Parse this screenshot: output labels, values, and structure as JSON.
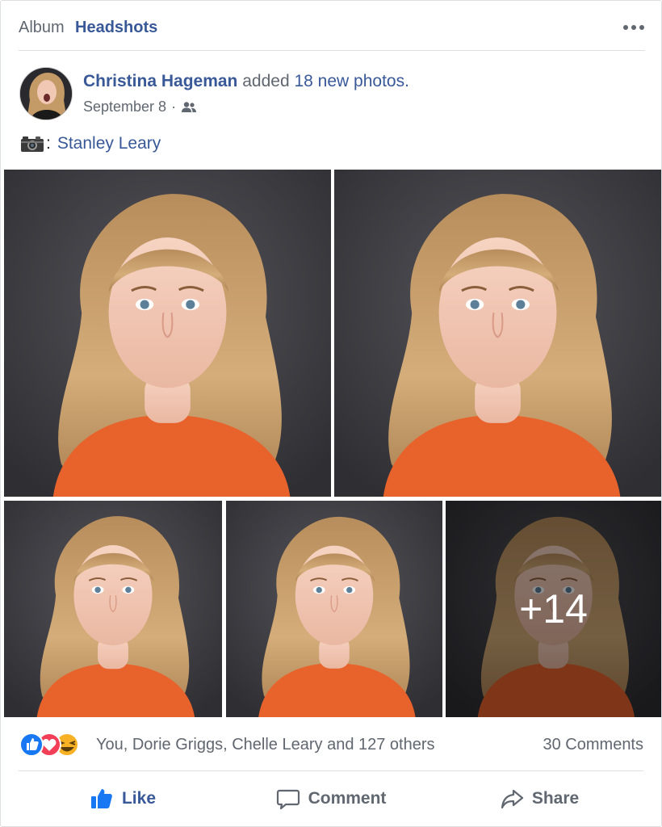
{
  "album": {
    "prefix": "Album",
    "name": "Headshots"
  },
  "post": {
    "author": "Christina Hageman",
    "action": "added",
    "photos_link": "18 new photos.",
    "date": "September 8",
    "separator": "·",
    "privacy_icon": "friends-icon"
  },
  "caption": {
    "icon": "camera-icon",
    "colon": ":",
    "link": "Stanley Leary"
  },
  "photos": {
    "more_count": "+14"
  },
  "reactions": {
    "icons": [
      "like-reaction-icon",
      "love-reaction-icon",
      "haha-reaction-icon"
    ],
    "text": "You, Dorie Griggs, Chelle Leary and 127 others",
    "comments": "30 Comments"
  },
  "actions": {
    "like": "Like",
    "comment": "Comment",
    "share": "Share"
  },
  "colors": {
    "link_blue": "#385898",
    "text_gray": "#606770",
    "like_blue": "#1877f2",
    "love_red": "#f33e58",
    "haha_yellow": "#f7b125",
    "shirt_orange": "#e8622c",
    "hair_blonde": "#c9a06a",
    "backdrop_gray": "#3f3f44"
  }
}
